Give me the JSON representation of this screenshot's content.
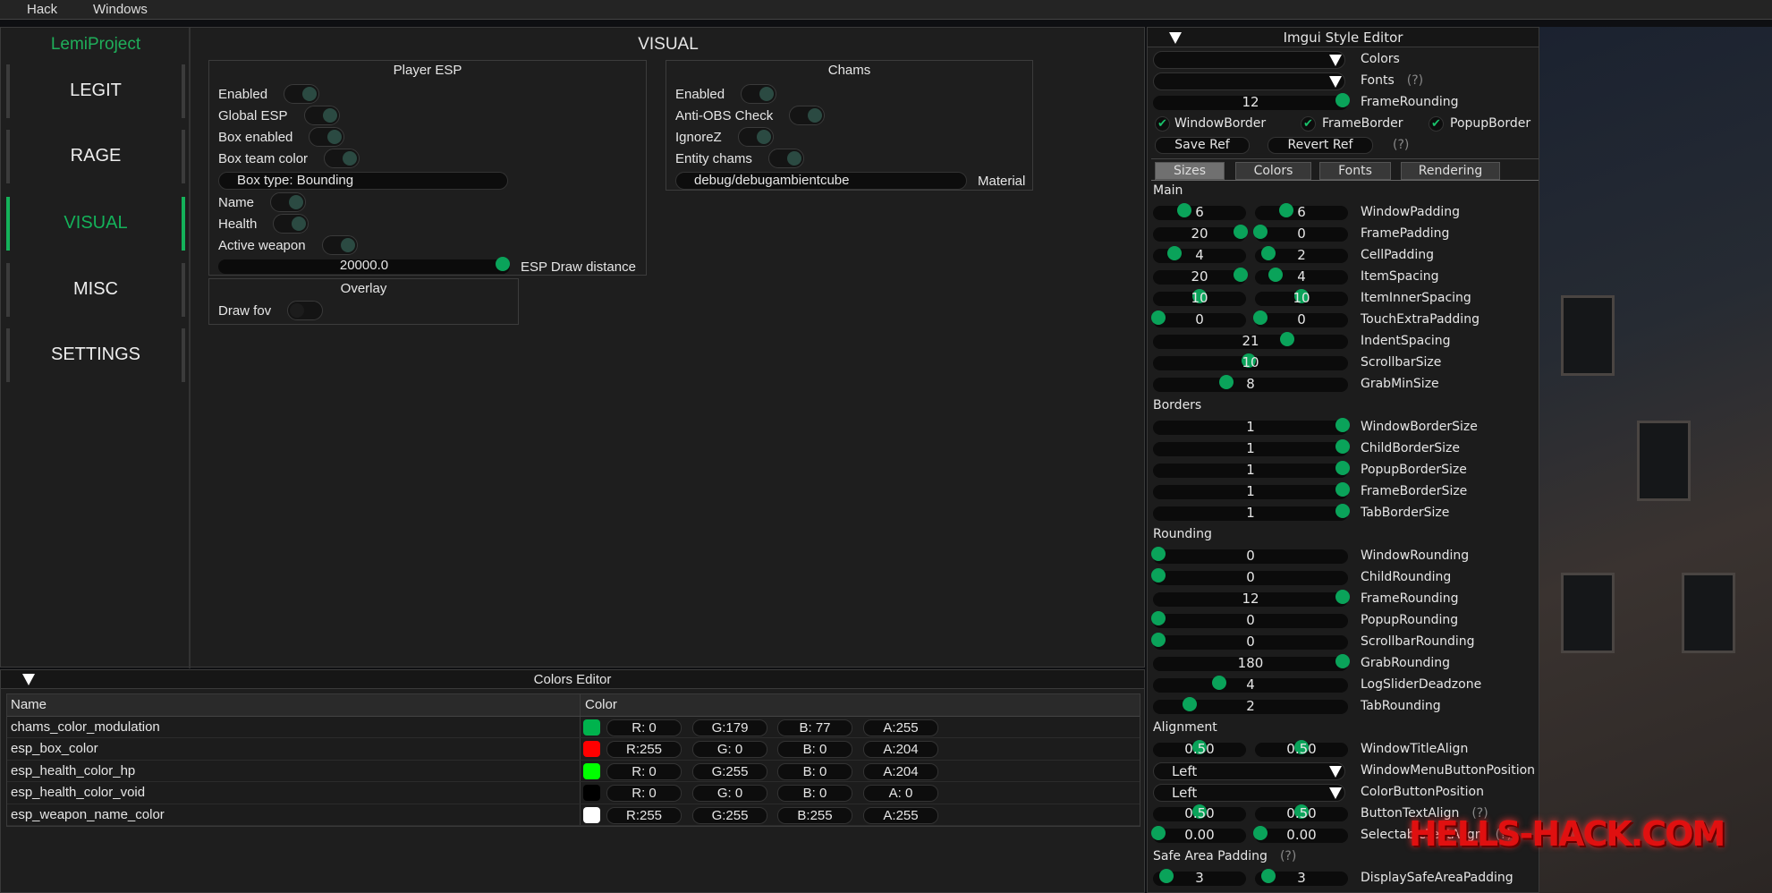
{
  "menubar": {
    "items": [
      "Hack",
      "Windows"
    ]
  },
  "main": {
    "brand": "LemiProject",
    "title": "VISUAL",
    "sidebar": [
      {
        "label": "LEGIT",
        "active": false
      },
      {
        "label": "RAGE",
        "active": false
      },
      {
        "label": "VISUAL",
        "active": true
      },
      {
        "label": "MISC",
        "active": false
      },
      {
        "label": "SETTINGS",
        "active": false
      }
    ],
    "player_esp": {
      "title": "Player ESP",
      "toggles": [
        {
          "label": "Enabled",
          "on": true
        },
        {
          "label": "Global ESP",
          "on": true
        },
        {
          "label": "Box enabled",
          "on": true
        },
        {
          "label": "Box team color",
          "on": true
        }
      ],
      "box_type": "Box type: Bounding",
      "toggles2": [
        {
          "label": "Name",
          "on": true
        },
        {
          "label": "Health",
          "on": true
        },
        {
          "label": "Active weapon",
          "on": true
        }
      ],
      "draw_distance": {
        "value": "20000.0",
        "label": "ESP Draw distance",
        "fraction": 1.0
      }
    },
    "chams": {
      "title": "Chams",
      "toggles": [
        {
          "label": "Enabled",
          "on": true
        },
        {
          "label": "Anti-OBS Check",
          "on": true
        },
        {
          "label": "IgnoreZ",
          "on": true
        },
        {
          "label": "Entity chams",
          "on": true
        }
      ],
      "material_value": "debug/debugambientcube",
      "material_label": "Material"
    },
    "overlay": {
      "title": "Overlay",
      "toggles": [
        {
          "label": "Draw fov",
          "on": false
        }
      ]
    }
  },
  "colors_editor": {
    "title": "Colors Editor",
    "columns": [
      "Name",
      "Color"
    ],
    "rows": [
      {
        "name": "chams_color_modulation",
        "swatch": "#00b34d",
        "r": "R: 0",
        "g": "G:179",
        "b": "B: 77",
        "a": "A:255"
      },
      {
        "name": "esp_box_color",
        "swatch": "#ff0000",
        "r": "R:255",
        "g": "G: 0",
        "b": "B: 0",
        "a": "A:204"
      },
      {
        "name": "esp_health_color_hp",
        "swatch": "#00ff00",
        "r": "R: 0",
        "g": "G:255",
        "b": "B: 0",
        "a": "A:204"
      },
      {
        "name": "esp_health_color_void",
        "swatch": "#000000",
        "r": "R: 0",
        "g": "G: 0",
        "b": "B: 0",
        "a": "A: 0"
      },
      {
        "name": "esp_weapon_name_color",
        "swatch": "#ffffff",
        "r": "R:255",
        "g": "G:255",
        "b": "B:255",
        "a": "A:255"
      }
    ]
  },
  "style_editor": {
    "title": "Imgui Style Editor",
    "colors_combo_label": "Colors",
    "fonts_combo_label": "Fonts",
    "help": "(?)",
    "frame_rounding": {
      "value": "12",
      "label": "FrameRounding",
      "fraction": 1.0
    },
    "checkboxes": [
      "WindowBorder",
      "FrameBorder",
      "PopupBorder"
    ],
    "save_ref": "Save Ref",
    "revert_ref": "Revert Ref",
    "tabs": [
      {
        "label": "Sizes",
        "active": true
      },
      {
        "label": "Colors"
      },
      {
        "label": "Fonts"
      },
      {
        "label": "Rendering"
      }
    ],
    "rows": [
      {
        "section": "Main"
      },
      {
        "label": "WindowPadding",
        "pair": [
          {
            "v": "6",
            "f": 0.32
          },
          {
            "v": "6",
            "f": 0.31
          }
        ]
      },
      {
        "label": "FramePadding",
        "pair": [
          {
            "v": "20",
            "f": 1.0
          },
          {
            "v": "0",
            "f": 0
          }
        ]
      },
      {
        "label": "CellPadding",
        "pair": [
          {
            "v": "4",
            "f": 0.2
          },
          {
            "v": "2",
            "f": 0.1
          }
        ]
      },
      {
        "label": "ItemSpacing",
        "pair": [
          {
            "v": "20",
            "f": 1.0
          },
          {
            "v": "4",
            "f": 0.19
          }
        ]
      },
      {
        "label": "ItemInnerSpacing",
        "pair": [
          {
            "v": "10",
            "f": 0.5
          },
          {
            "v": "10",
            "f": 0.5
          }
        ]
      },
      {
        "label": "TouchExtraPadding",
        "pair": [
          {
            "v": "0",
            "f": 0
          },
          {
            "v": "0",
            "f": 0
          }
        ]
      },
      {
        "label": "IndentSpacing",
        "single": {
          "v": "21",
          "f": 0.7
        }
      },
      {
        "label": "ScrollbarSize",
        "single": {
          "v": "10",
          "f": 0.49
        }
      },
      {
        "label": "GrabMinSize",
        "single": {
          "v": "8",
          "f": 0.37
        }
      },
      {
        "section": "Borders"
      },
      {
        "label": "WindowBorderSize",
        "single": {
          "v": "1",
          "f": 1.0
        }
      },
      {
        "label": "ChildBorderSize",
        "single": {
          "v": "1",
          "f": 1.0
        }
      },
      {
        "label": "PopupBorderSize",
        "single": {
          "v": "1",
          "f": 1.0
        }
      },
      {
        "label": "FrameBorderSize",
        "single": {
          "v": "1",
          "f": 1.0
        }
      },
      {
        "label": "TabBorderSize",
        "single": {
          "v": "1",
          "f": 1.0
        }
      },
      {
        "section": "Rounding"
      },
      {
        "label": "WindowRounding",
        "single": {
          "v": "0",
          "f": 0
        }
      },
      {
        "label": "ChildRounding",
        "single": {
          "v": "0",
          "f": 0
        }
      },
      {
        "label": "FrameRounding",
        "single": {
          "v": "12",
          "f": 1.0
        }
      },
      {
        "label": "PopupRounding",
        "single": {
          "v": "0",
          "f": 0
        }
      },
      {
        "label": "ScrollbarRounding",
        "single": {
          "v": "0",
          "f": 0
        }
      },
      {
        "label": "GrabRounding",
        "single": {
          "v": "180",
          "f": 1.0
        }
      },
      {
        "label": "LogSliderDeadzone",
        "single": {
          "v": "4",
          "f": 0.33
        }
      },
      {
        "label": "TabRounding",
        "single": {
          "v": "2",
          "f": 0.17
        }
      },
      {
        "section": "Alignment"
      },
      {
        "label": "WindowTitleAlign",
        "pair": [
          {
            "v": "0.50",
            "f": 0.5
          },
          {
            "v": "0.50",
            "f": 0.5
          }
        ]
      },
      {
        "label": "WindowMenuButtonPosition",
        "combo": "Left"
      },
      {
        "label": "ColorButtonPosition",
        "combo": "Left"
      },
      {
        "label": "ButtonTextAlign",
        "pair": [
          {
            "v": "0.50",
            "f": 0.5
          },
          {
            "v": "0.50",
            "f": 0.5
          }
        ],
        "help": true
      },
      {
        "label": "SelectableTextAlign",
        "pair": [
          {
            "v": "0.00",
            "f": 0
          },
          {
            "v": "0.00",
            "f": 0
          }
        ],
        "help": true
      },
      {
        "section": "Safe Area Padding",
        "help": true
      },
      {
        "label": "DisplaySafeAreaPadding",
        "pair": [
          {
            "v": "3",
            "f": 0.1
          },
          {
            "v": "3",
            "f": 0.1
          }
        ]
      }
    ]
  },
  "watermark": "HELLS-HACK.COM",
  "colors": {
    "accent": "#0aa35a",
    "brand": "#1fae5a"
  }
}
